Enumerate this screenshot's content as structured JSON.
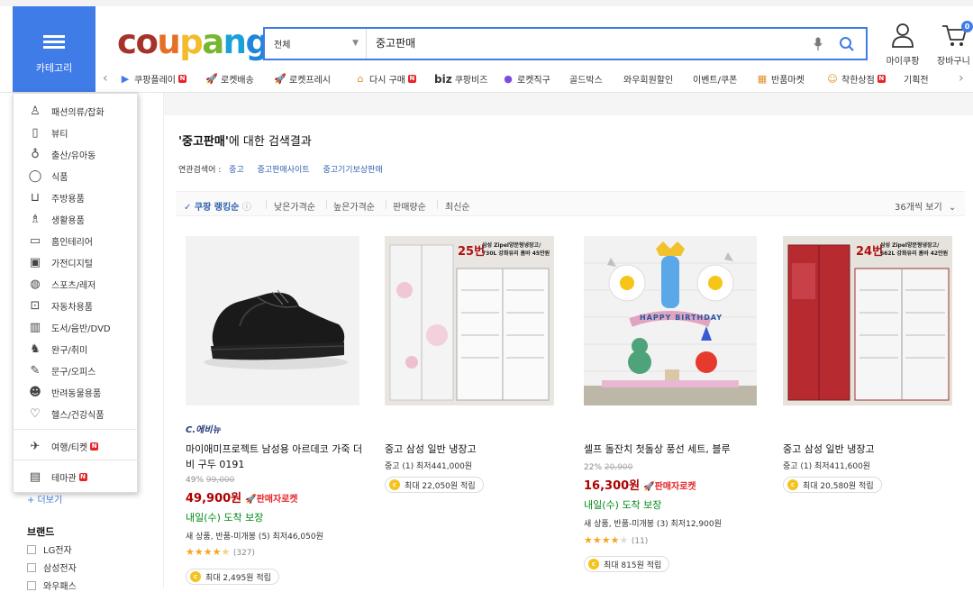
{
  "header": {
    "category_label": "카테고리",
    "logo_letters": [
      "c",
      "o",
      "u",
      "p",
      "a",
      "n",
      "g"
    ],
    "logo_colors": [
      "#a5332b",
      "#a5332b",
      "#e66f28",
      "#f3bc2b",
      "#76b732",
      "#1aa1d8",
      "#1f86d9"
    ],
    "search_scope": "전체",
    "search_query": "중고판매",
    "my_coupang": "마이쿠팡",
    "cart": "장바구니",
    "cart_count": "0"
  },
  "nav": [
    {
      "label": "쿠팡플레이",
      "badge": "N",
      "icon": "play-icon"
    },
    {
      "label": "로켓배송",
      "badge": "",
      "icon": "rocket-icon"
    },
    {
      "label": "로켓프레시",
      "badge": "",
      "icon": "rocket-fresh-icon"
    },
    {
      "label": "다시 구매",
      "badge": "N",
      "icon": "house-icon"
    },
    {
      "label": "쿠팡비즈",
      "badge": "",
      "icon": "biz-logo",
      "prefix": "biz"
    },
    {
      "label": "로켓직구",
      "badge": "",
      "icon": "globe-icon"
    },
    {
      "label": "골드박스",
      "badge": "",
      "icon": ""
    },
    {
      "label": "와우회원할인",
      "badge": "",
      "icon": ""
    },
    {
      "label": "이벤트/쿠폰",
      "badge": "",
      "icon": ""
    },
    {
      "label": "반품마켓",
      "badge": "",
      "icon": "market-icon"
    },
    {
      "label": "착한상점",
      "badge": "N",
      "icon": "shop-icon"
    },
    {
      "label": "기획전",
      "badge": "",
      "icon": ""
    }
  ],
  "categories": [
    {
      "label": "패션의류/잡화",
      "icon": "dress-icon"
    },
    {
      "label": "뷰티",
      "icon": "cosmetics-icon"
    },
    {
      "label": "출산/유아동",
      "icon": "baby-bottle-icon"
    },
    {
      "label": "식품",
      "icon": "apple-icon"
    },
    {
      "label": "주방용품",
      "icon": "pot-icon"
    },
    {
      "label": "생활용품",
      "icon": "bottle-icon"
    },
    {
      "label": "홈인테리어",
      "icon": "sofa-icon"
    },
    {
      "label": "가전디지털",
      "icon": "camera-icon"
    },
    {
      "label": "스포츠/레저",
      "icon": "ball-icon"
    },
    {
      "label": "자동차용품",
      "icon": "car-icon"
    },
    {
      "label": "도서/음반/DVD",
      "icon": "book-icon"
    },
    {
      "label": "완구/취미",
      "icon": "toy-icon"
    },
    {
      "label": "문구/오피스",
      "icon": "pen-icon"
    },
    {
      "label": "반려동물용품",
      "icon": "dog-icon"
    },
    {
      "label": "헬스/건강식품",
      "icon": "heart-icon"
    },
    {
      "label": "여행/티켓",
      "icon": "plane-icon",
      "badge": "N"
    },
    {
      "label": "테마관",
      "icon": "store-icon",
      "badge": "N"
    }
  ],
  "sidebar": {
    "more": "+ 더보기",
    "brand_title": "브랜드",
    "brands": [
      "LG전자",
      "삼성전자",
      "와우패스"
    ]
  },
  "results": {
    "title_query": "'중고판매'",
    "title_suffix": "에 대한 검색결과",
    "related_label": "연관검색어 :",
    "related": [
      "중고",
      "중고판매사이트",
      "중고기기보상판매"
    ]
  },
  "sort": {
    "options": [
      "쿠팡 랭킹순",
      "낮은가격순",
      "높은가격순",
      "판매량순",
      "최신순"
    ],
    "active": "쿠팡 랭킹순",
    "view": "36개씩 보기"
  },
  "products": [
    {
      "brand_tag": "C.에비뉴",
      "title": "마이애미프로젝트 남성용 아르데코 가죽 더비 구두 0191",
      "discount": "49%",
      "original_price": "99,000",
      "price": "49,900원",
      "rocket": "판매자로켓",
      "delivery": "내일(수) 도착 보장",
      "options": "새 상품, 반품-미개봉 (5) 최저46,050원",
      "rating": 4.5,
      "reviews": "(327)",
      "reward": "최대 2,495원 적립"
    },
    {
      "title": "중고 삼성 일반 냉장고",
      "options": "중고 (1) 최저441,000원",
      "reward": "최대 22,050원 적립",
      "overlay_num": "25번",
      "overlay_text": "삼성 Zipel양문형냉장고/ 730L 강화유리 홈바 45만원"
    },
    {
      "title": "셀프 돌잔치 첫돌상 풍선 세트, 블루",
      "discount": "22%",
      "original_price": "20,900",
      "price": "16,300원",
      "rocket": "판매자로켓",
      "delivery": "내일(수) 도착 보장",
      "options": "새 상품, 반품-미개봉 (3) 최저12,900원",
      "rating": 4.0,
      "reviews": "(11)",
      "reward": "최대 815원 적립",
      "banner": "HAPPY BIRTHDAY",
      "big_number": "1"
    },
    {
      "title": "중고 삼성 일반 냉장고",
      "options": "중고 (1) 최저411,600원",
      "reward": "최대 20,580원 적립",
      "overlay_num": "24번",
      "overlay_text": "삼성 Zipel양문형냉장고/ 662L 강화유리 홈바 42만원"
    }
  ],
  "colors": {
    "accent": "#3f7ce8",
    "price": "#ae0000",
    "delivery": "#00891a",
    "link": "#3362b0"
  }
}
